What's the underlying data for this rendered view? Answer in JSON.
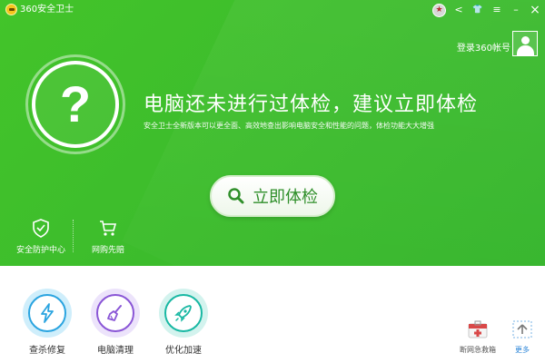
{
  "app": {
    "title": "360安全卫士"
  },
  "titlebar": {
    "medal": "★",
    "share": "<",
    "skin": "👕",
    "menu": "≡",
    "minimize": "–",
    "close": "×"
  },
  "account": {
    "login_label": "登录360帐号"
  },
  "status": {
    "symbol": "?",
    "headline": "电脑还未进行过体检，建议立即体检",
    "subline": "安全卫士全新版本可以更全面、高效地查出影响电脑安全和性能的问题，体检功能大大增强"
  },
  "check_button": {
    "label": "立即体检"
  },
  "left_tools": [
    {
      "label": "安全防护中心",
      "icon": "shield-icon"
    },
    {
      "label": "网购先赔",
      "icon": "shopping-cart-icon"
    }
  ],
  "features": [
    {
      "label": "查杀修复",
      "icon": "lightning-icon",
      "color": "#2aa4e0",
      "ring": "#cfeefb"
    },
    {
      "label": "电脑清理",
      "icon": "broom-icon",
      "color": "#8a56d6",
      "ring": "#ece3fb"
    },
    {
      "label": "优化加速",
      "icon": "rocket-icon",
      "color": "#19b8a3",
      "ring": "#d3f3ee"
    }
  ],
  "mini_tools": [
    {
      "label": "断网急救箱",
      "icon": "first-aid-kit-icon"
    },
    {
      "label": "更多",
      "icon": "more-arrow-icon"
    }
  ],
  "colors": {
    "brand_green": "#3dbd2c",
    "button_text": "#2f8f2a",
    "link_blue": "#2d86d8"
  }
}
